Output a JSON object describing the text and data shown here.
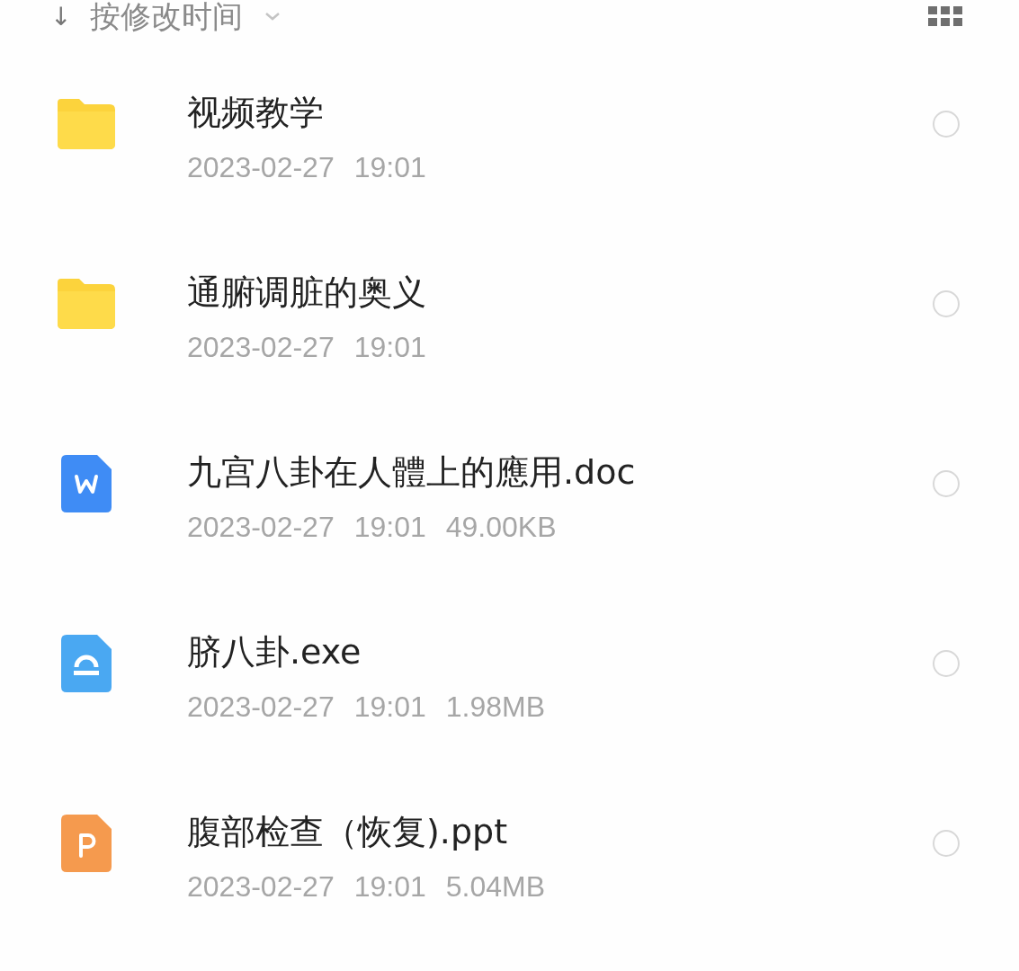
{
  "sort": {
    "arrow": "↓",
    "label": "按修改时间"
  },
  "files": [
    {
      "kind": "folder",
      "name": "视频教学",
      "date": "2023-02-27",
      "time": "19:01",
      "selected": false
    },
    {
      "kind": "folder",
      "name": "通腑调脏的奥义",
      "date": "2023-02-27",
      "time": "19:01",
      "selected": false
    },
    {
      "kind": "doc",
      "name": "九宫八卦在人體上的應用.doc",
      "date": "2023-02-27",
      "time": "19:01",
      "size": "49.00KB",
      "selected": false
    },
    {
      "kind": "exe",
      "name": "脐八卦.exe",
      "date": "2023-02-27",
      "time": "19:01",
      "size": "1.98MB",
      "selected": false
    },
    {
      "kind": "ppt",
      "name": "腹部检查（恢复).ppt",
      "date": "2023-02-27",
      "time": "19:01",
      "size": "5.04MB",
      "selected": false
    }
  ]
}
